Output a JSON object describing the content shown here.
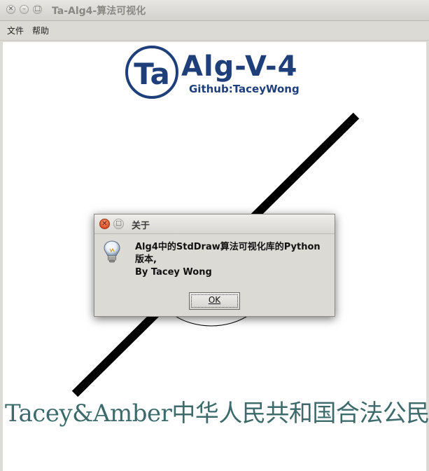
{
  "window": {
    "title": "Ta-Alg4-算法可视化"
  },
  "menu": {
    "items": [
      "文件",
      "帮助"
    ]
  },
  "canvas": {
    "logo_letters": "Ta",
    "logo_title": "Alg-V-4",
    "logo_subtitle": "Github:TaceyWong",
    "bottom_text": "Tacey&Amber中华人民共和国合法公民",
    "colors": {
      "logo": "#1f3f7a",
      "bottom_text": "#3d6b6c",
      "line": "#000000"
    }
  },
  "dialog": {
    "title": "关于",
    "message_lines": [
      "Alg4中的StdDraw算法可视化库的Python",
      "版本,",
      "By Tacey Wong"
    ],
    "ok_label": "OK",
    "icon": "lightbulb-icon"
  }
}
